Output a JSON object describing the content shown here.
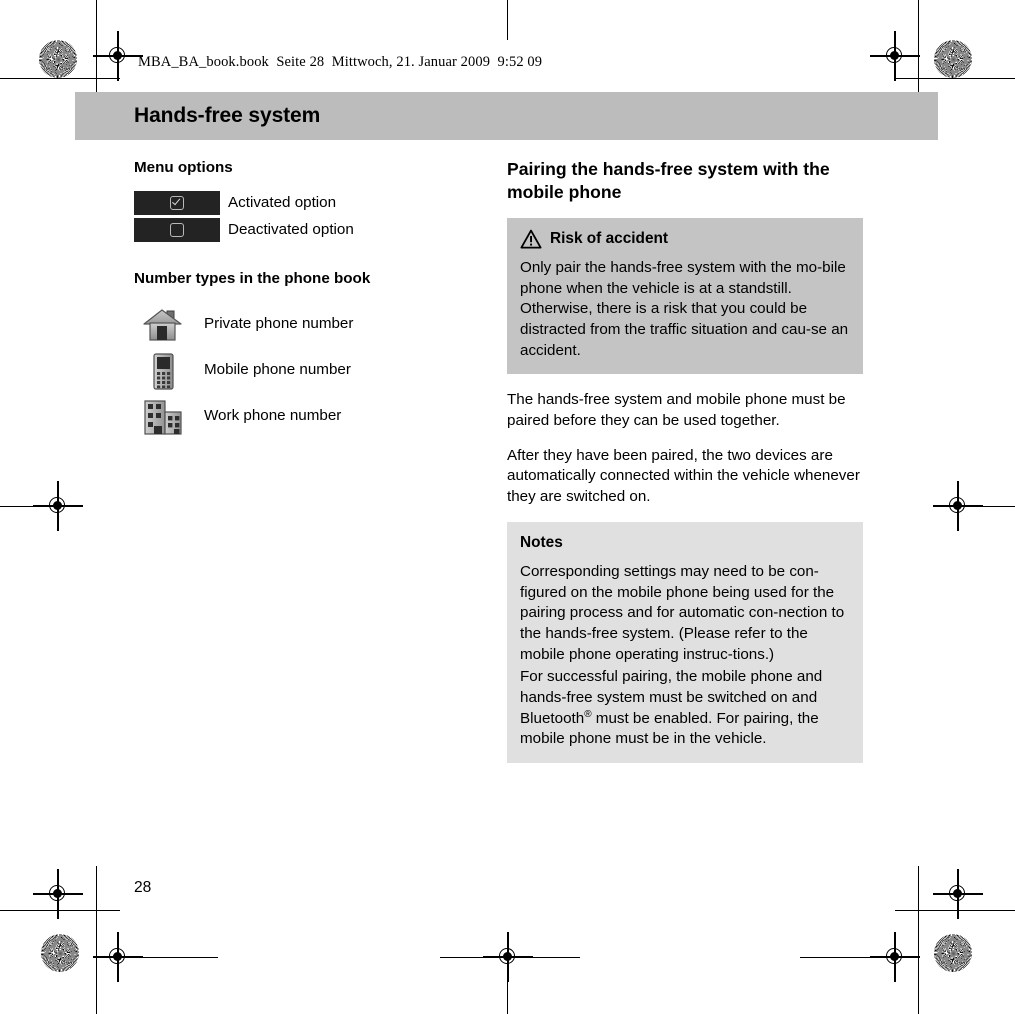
{
  "document": {
    "running_head": "MBA_BA_book.book  Seite 28  Mittwoch, 21. Januar 2009  9:52 09",
    "chapter_title": "Hands-free system",
    "page_number": "28",
    "colors": {
      "title_band": "#bcbcbc",
      "warning_box": "#c4c4c4",
      "note_box": "#e0e0e0",
      "chip_dark": "#232323",
      "text": "#000000"
    }
  },
  "left_column": {
    "menu_options": {
      "heading": "Menu options",
      "rows": [
        {
          "icon": "checkbox-checked-icon",
          "label": "Activated option"
        },
        {
          "icon": "checkbox-unchecked-icon",
          "label": "Deactivated option"
        }
      ]
    },
    "number_types": {
      "heading": "Number types in the phone book",
      "rows": [
        {
          "icon": "house-icon",
          "label": "Private phone number"
        },
        {
          "icon": "mobile-phone-icon",
          "label": "Mobile phone number"
        },
        {
          "icon": "office-building-icon",
          "label": "Work phone number"
        }
      ]
    }
  },
  "right_column": {
    "heading": "Pairing the hands-free system with the mobile phone",
    "warning": {
      "icon": "warning-triangle-icon",
      "title": "Risk of accident",
      "body": "Only pair the hands-free system with the mo-bile phone when the vehicle is at a standstill. Otherwise, there is a risk that you could be distracted from the traffic situation and cau-se an accident."
    },
    "paragraphs": [
      "The hands-free system and mobile phone must be paired before they can be used together.",
      "After they have been paired, the two devices are automatically connected within the vehicle whenever they are switched on."
    ],
    "notes": {
      "title": "Notes",
      "paragraph_1": "Corresponding settings may need to be con-figured on the mobile phone being used for the pairing process and for automatic con-nection to the hands-free system. (Please refer to the mobile phone operating instruc-tions.)",
      "paragraph_2_before": "For successful pairing, the mobile phone and hands-free system must be switched on and Bluetooth",
      "paragraph_2_mark": "®",
      "paragraph_2_after": " must be enabled. For pairing, the mobile phone must be in the vehicle."
    }
  }
}
